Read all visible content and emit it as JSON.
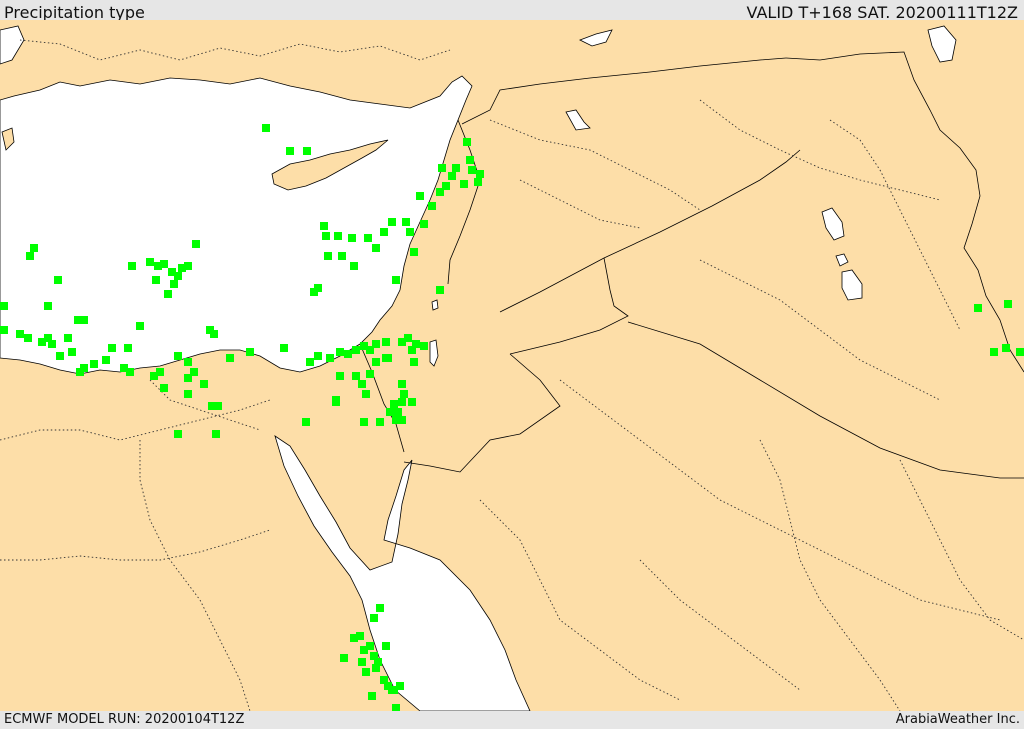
{
  "header": {
    "title": "Precipitation type",
    "valid": "VALID T+168 SAT. 20200111T12Z"
  },
  "footer": {
    "model_run": "ECMWF MODEL RUN: 20200104T12Z",
    "credit": "ArabiaWeather Inc."
  },
  "colors": {
    "land": "#fddea8",
    "water": "#ffffff",
    "precip_rain": "#00ff00"
  }
}
